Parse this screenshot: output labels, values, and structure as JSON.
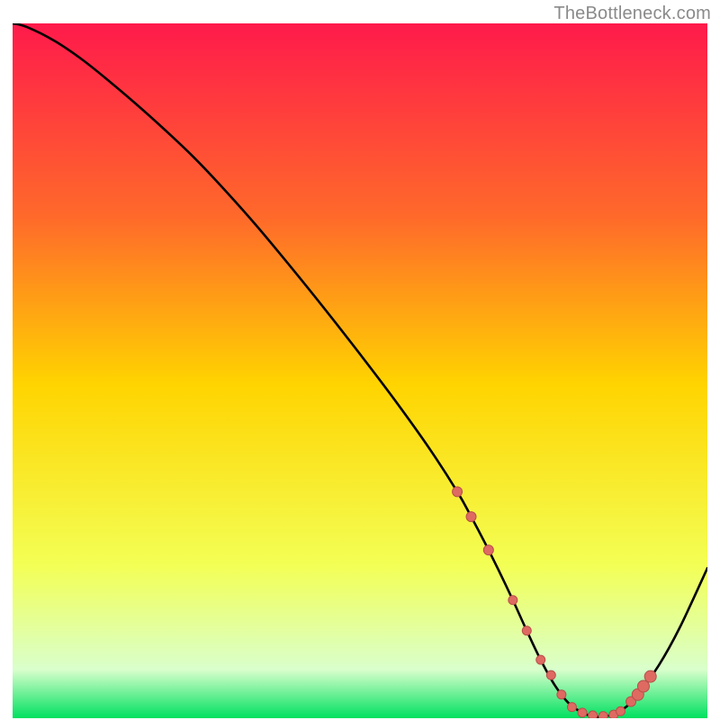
{
  "attribution": "TheBottleneck.com",
  "colors": {
    "grad_top": "#ff1a4b",
    "grad_q1": "#ff6a2a",
    "grad_mid": "#ffd400",
    "grad_q3": "#f3ff55",
    "grad_low": "#d9ffcc",
    "grad_bottom": "#00e060",
    "curve": "#000000",
    "dot_fill": "#de6a62",
    "dot_stroke": "#b94f4a"
  },
  "chart_data": {
    "type": "line",
    "title": "",
    "xlabel": "",
    "ylabel": "",
    "xlim": [
      0,
      100
    ],
    "ylim": [
      0,
      100
    ],
    "series": [
      {
        "name": "curve",
        "x": [
          0,
          2,
          6,
          10,
          14,
          18,
          22,
          26,
          30,
          35,
          40,
          45,
          50,
          55,
          60,
          64,
          66,
          68,
          70,
          72,
          74,
          76,
          78,
          80,
          82,
          84,
          86,
          88,
          90,
          93,
          96,
          100
        ],
        "y": [
          100,
          99.5,
          97.5,
          94.8,
          91.6,
          88.2,
          84.6,
          80.8,
          76.6,
          71.0,
          65.0,
          58.8,
          52.4,
          45.8,
          38.8,
          32.6,
          29.0,
          25.2,
          21.2,
          17.0,
          12.6,
          8.4,
          4.8,
          2.2,
          0.8,
          0.2,
          0.4,
          1.4,
          3.4,
          7.6,
          13.0,
          21.6
        ]
      }
    ],
    "dots": {
      "x": [
        64.0,
        66.0,
        68.5,
        72.0,
        74.0,
        76.0,
        77.5,
        79.0,
        80.5,
        82.0,
        83.5,
        85.0,
        86.5,
        87.5,
        89.0,
        90.0,
        90.8,
        91.8
      ],
      "y": [
        32.6,
        29.0,
        24.2,
        17.0,
        12.6,
        8.4,
        6.2,
        3.4,
        1.6,
        0.8,
        0.4,
        0.3,
        0.5,
        1.0,
        2.4,
        3.4,
        4.6,
        6.0
      ],
      "r": [
        5.5,
        5.5,
        5.5,
        5.0,
        5.0,
        5.0,
        5.0,
        5.0,
        5.0,
        5.0,
        5.0,
        5.0,
        5.0,
        5.0,
        5.5,
        6.5,
        6.5,
        6.5
      ]
    }
  }
}
